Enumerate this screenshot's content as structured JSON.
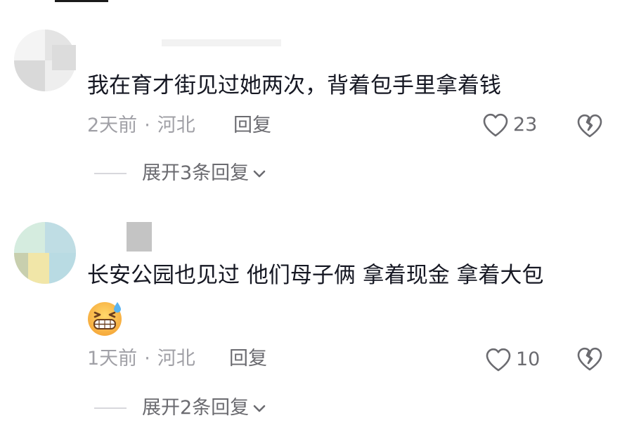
{
  "comments": [
    {
      "text": "我在育才街见过她两次，背着包手里拿着钱",
      "time": "2天前",
      "location": "河北",
      "reply_label": "回复",
      "likes": "23",
      "expand_label": "展开3条回复",
      "avatar_icon": "blurred-avatar"
    },
    {
      "text": "长安公园也见过 他们母子俩 拿着现金 拿着大包",
      "emoji_icon": "grinning-sweat-emoji",
      "time": "1天前",
      "location": "河北",
      "reply_label": "回复",
      "likes": "10",
      "expand_label": "展开2条回复",
      "avatar_icon": "blurred-avatar"
    }
  ],
  "separator": "·",
  "colors": {
    "text_primary": "#161823",
    "text_secondary": "#a0a0a6",
    "text_action": "#6b6b70"
  }
}
